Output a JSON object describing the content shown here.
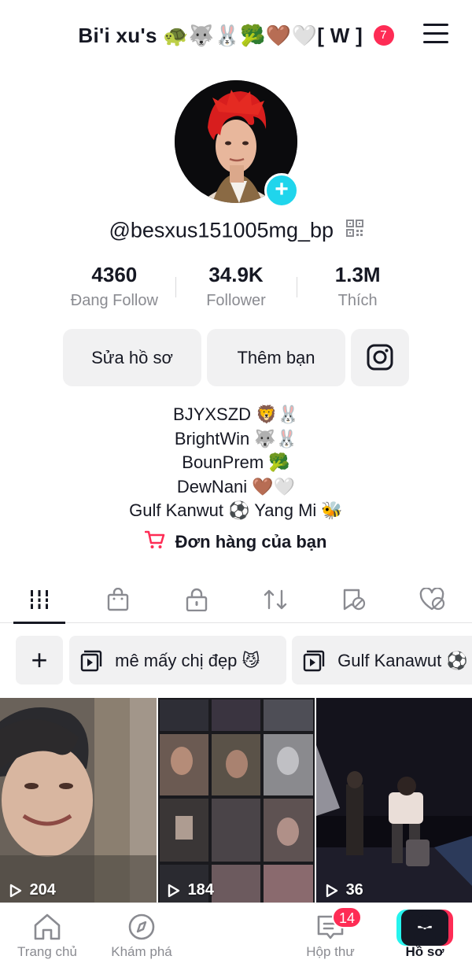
{
  "header": {
    "title": "Bi'i xu's 🐢🐺🐰🥦🤎🤍[ W ]",
    "notification_count": "7"
  },
  "profile": {
    "username": "@besxus151005mg_bp",
    "stats": [
      {
        "value": "4360",
        "label": "Đang Follow"
      },
      {
        "value": "34.9K",
        "label": "Follower"
      },
      {
        "value": "1.3M",
        "label": "Thích"
      }
    ],
    "edit_label": "Sửa hồ sơ",
    "add_friend_label": "Thêm bạn",
    "bio_lines": [
      "BJYXSZD 🦁🐰",
      "BrightWin 🐺🐰",
      "BounPrem 🥦",
      "DewNani 🤎🤍",
      "Gulf Kanwut ⚽ Yang Mi 🐝"
    ],
    "order_label": "Đơn hàng của bạn"
  },
  "tabs": [
    "videos-grid-icon",
    "shop-bag-icon",
    "private-lock-icon",
    "repost-icon",
    "saved-icon",
    "liked-hidden-icon"
  ],
  "collections": [
    {
      "label": "mê mấy chị đẹp 😼"
    },
    {
      "label": "Gulf Kanawut ⚽"
    }
  ],
  "videos": [
    {
      "views": "204"
    },
    {
      "views": "184"
    },
    {
      "views": "36"
    }
  ],
  "bottom_nav": {
    "home": "Trang chủ",
    "discover": "Khám phá",
    "inbox": "Hộp thư",
    "inbox_badge": "14",
    "profile": "Hồ sơ"
  },
  "colors": {
    "accent_red": "#fe2c55",
    "accent_cyan": "#25f4ee",
    "avatar_add": "#20d5ec"
  }
}
